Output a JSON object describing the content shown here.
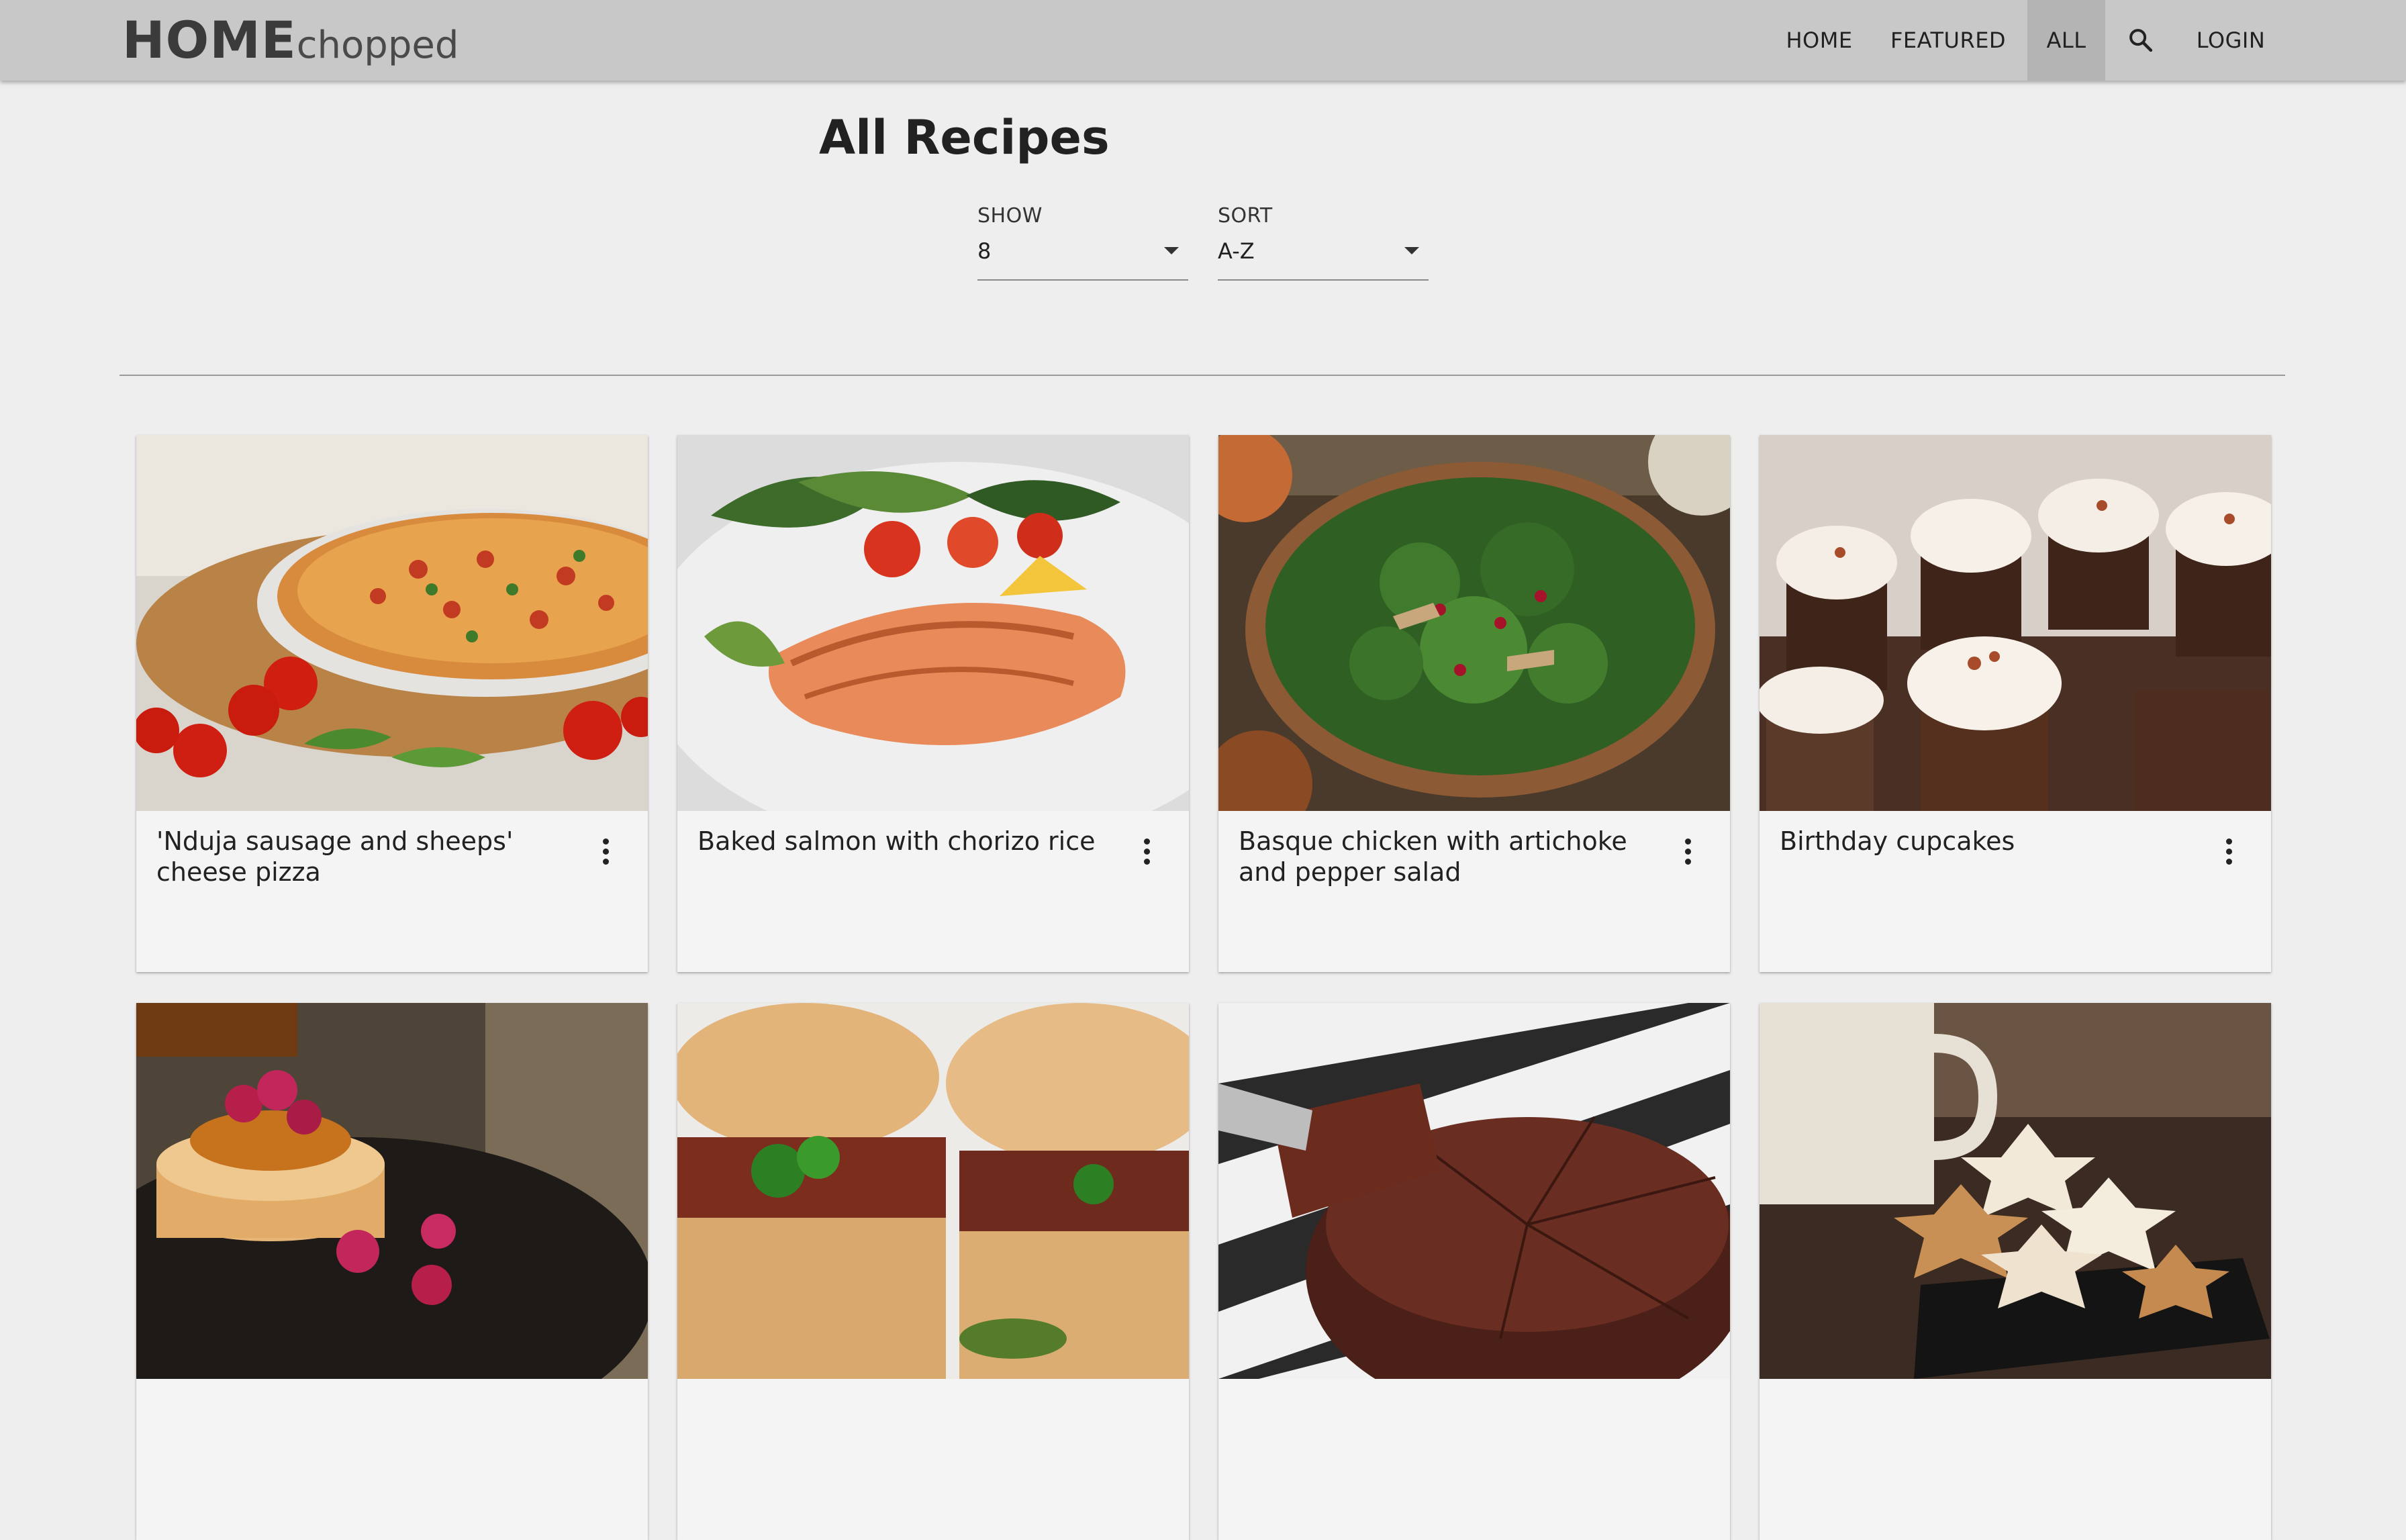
{
  "brand": {
    "bold": "HOME",
    "light": "chopped"
  },
  "nav": {
    "home": "HOME",
    "featured": "FEATURED",
    "all": "ALL",
    "search_icon": "search-icon",
    "login": "LOGIN"
  },
  "page": {
    "title": "All Recipes"
  },
  "filters": {
    "show": {
      "label": "SHOW",
      "value": "8"
    },
    "sort": {
      "label": "SORT",
      "value": "A-Z"
    }
  },
  "recipes": [
    {
      "title": "'Nduja sausage and sheeps' cheese pizza",
      "image": "pizza-photo"
    },
    {
      "title": "Baked salmon with chorizo rice",
      "image": "salmon-photo"
    },
    {
      "title": "Basque chicken with artichoke and pepper salad",
      "image": "salad-photo"
    },
    {
      "title": "Birthday cupcakes",
      "image": "cupcakes-photo"
    },
    {
      "title": "",
      "image": "pancakes-photo"
    },
    {
      "title": "",
      "image": "burger-photo"
    },
    {
      "title": "",
      "image": "chocolate-cake-photo"
    },
    {
      "title": "",
      "image": "star-cookies-photo"
    }
  ],
  "colors": {
    "appbar": "#c8c8c8",
    "appbar_active": "#b4b4b4",
    "page_background": "#eeeeee",
    "card_background": "#f4f4f4"
  }
}
